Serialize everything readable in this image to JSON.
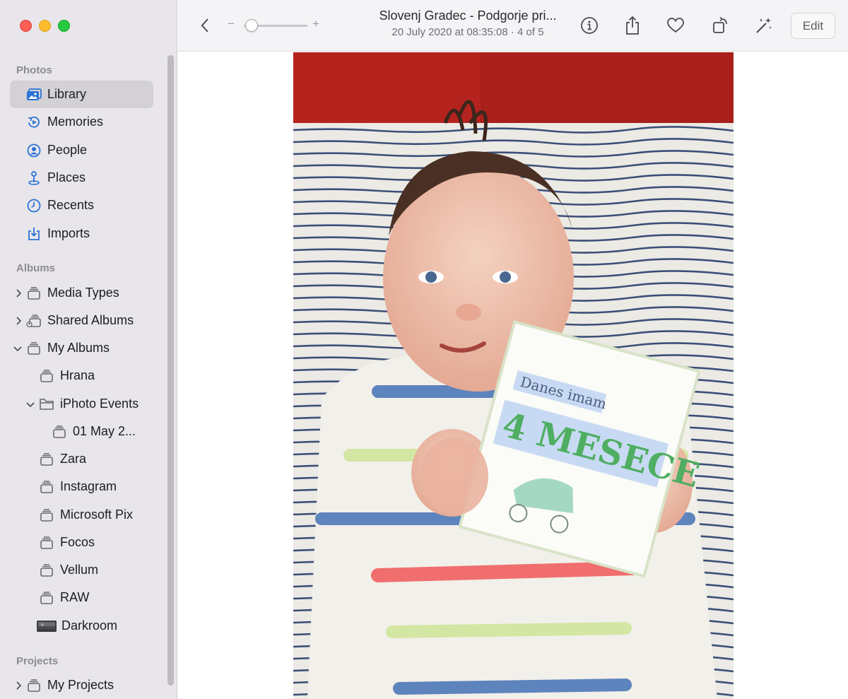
{
  "sidebar": {
    "sections": {
      "photos": "Photos",
      "albums": "Albums",
      "projects": "Projects"
    },
    "photos_items": [
      {
        "label": "Library",
        "icon": "library-icon"
      },
      {
        "label": "Memories",
        "icon": "memories-icon"
      },
      {
        "label": "People",
        "icon": "people-icon"
      },
      {
        "label": "Places",
        "icon": "places-icon"
      },
      {
        "label": "Recents",
        "icon": "recents-icon"
      },
      {
        "label": "Imports",
        "icon": "imports-icon"
      }
    ],
    "album_items": [
      {
        "label": "Media Types",
        "icon": "album-stack-icon"
      },
      {
        "label": "Shared Albums",
        "icon": "shared-album-icon"
      },
      {
        "label": "My Albums",
        "icon": "album-stack-icon"
      },
      {
        "label": "Hrana",
        "icon": "album-stack-icon"
      },
      {
        "label": "iPhoto Events",
        "icon": "folder-icon"
      },
      {
        "label": "01 May 2...",
        "icon": "album-stack-icon"
      },
      {
        "label": "Zara",
        "icon": "album-stack-icon"
      },
      {
        "label": "Instagram",
        "icon": "album-stack-icon"
      },
      {
        "label": "Microsoft Pix",
        "icon": "album-stack-icon"
      },
      {
        "label": "Focos",
        "icon": "album-stack-icon"
      },
      {
        "label": "Vellum",
        "icon": "album-stack-icon"
      },
      {
        "label": "RAW",
        "icon": "album-stack-icon"
      },
      {
        "label": "Darkroom",
        "icon": "darkroom-thumbnail"
      }
    ],
    "project_items": [
      {
        "label": "My Projects",
        "icon": "album-stack-icon"
      }
    ]
  },
  "toolbar": {
    "title": "Slovenj Gradec - Podgorje pri...",
    "subtitle": "20 July 2020 at 08:35:08  ·  4 of 5",
    "zoom_minus": "−",
    "zoom_plus": "+",
    "zoom_level": 0.05,
    "edit_label": "Edit"
  },
  "photo": {
    "card_line1": "Danes imam",
    "card_line2": "4 MESECE"
  },
  "colors": {
    "accent": "#2b73d6",
    "sidebar_bg": "#e8e6ea",
    "selected_bg": "#d3d1d6"
  }
}
